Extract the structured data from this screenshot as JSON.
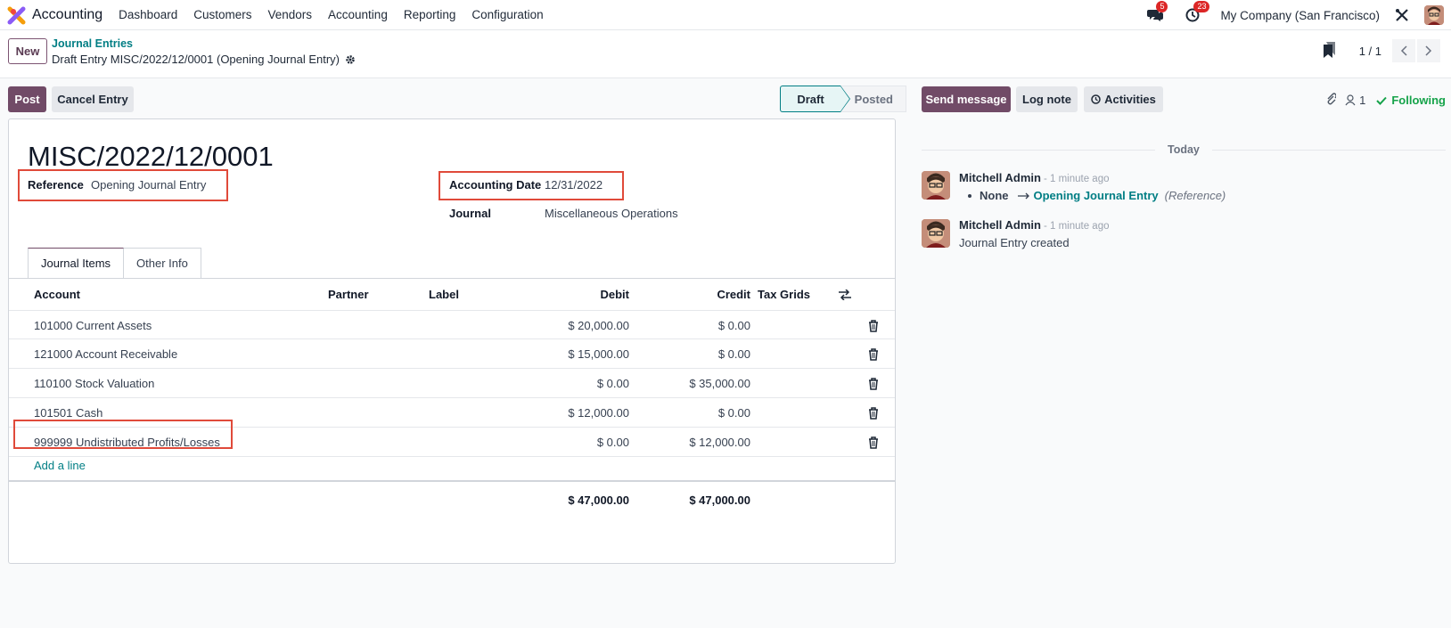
{
  "app": {
    "title": "Accounting"
  },
  "nav": {
    "items": [
      "Dashboard",
      "Customers",
      "Vendors",
      "Accounting",
      "Reporting",
      "Configuration"
    ],
    "messages_badge": "5",
    "activities_badge": "23",
    "company": "My Company (San Francisco)"
  },
  "control": {
    "new_label": "New",
    "breadcrumb_parent": "Journal Entries",
    "breadcrumb_current": "Draft Entry MISC/2022/12/0001 (Opening Journal Entry)",
    "pager": "1 / 1"
  },
  "actions": {
    "post": "Post",
    "cancel": "Cancel Entry"
  },
  "status": {
    "draft": "Draft",
    "posted": "Posted",
    "current": "Draft"
  },
  "form": {
    "name": "MISC/2022/12/0001",
    "reference_label": "Reference",
    "reference_value": "Opening Journal Entry",
    "date_label": "Accounting Date",
    "date_value": "12/31/2022",
    "journal_label": "Journal",
    "journal_value": "Miscellaneous Operations"
  },
  "tabs": [
    "Journal Items",
    "Other Info"
  ],
  "table": {
    "headers": {
      "account": "Account",
      "partner": "Partner",
      "label": "Label",
      "debit": "Debit",
      "credit": "Credit",
      "tax_grids": "Tax Grids"
    },
    "rows": [
      {
        "account": "101000 Current Assets",
        "debit": "$ 20,000.00",
        "credit": "$ 0.00"
      },
      {
        "account": "121000 Account Receivable",
        "debit": "$ 15,000.00",
        "credit": "$ 0.00"
      },
      {
        "account": "110100 Stock Valuation",
        "debit": "$ 0.00",
        "credit": "$ 35,000.00"
      },
      {
        "account": "101501 Cash",
        "debit": "$ 12,000.00",
        "credit": "$ 0.00"
      },
      {
        "account": "999999 Undistributed Profits/Losses",
        "debit": "$ 0.00",
        "credit": "$ 12,000.00"
      }
    ],
    "add_line": "Add a line",
    "total_debit": "$ 47,000.00",
    "total_credit": "$ 47,000.00"
  },
  "chatter": {
    "send_message": "Send message",
    "log_note": "Log note",
    "activities": "Activities",
    "followers_count": "1",
    "following": "Following",
    "date_separator": "Today",
    "messages": [
      {
        "author": "Mitchell Admin",
        "time": "- 1 minute ago",
        "old_value": "None",
        "new_value": "Opening Journal Entry",
        "field": "(Reference)"
      },
      {
        "author": "Mitchell Admin",
        "time": "- 1 minute ago",
        "body": "Journal Entry created"
      }
    ]
  },
  "colors": {
    "primary": "#714b67",
    "teal": "#017e84",
    "highlight": "#e04a3a",
    "following": "#16a34a",
    "badge": "#dc2626"
  }
}
